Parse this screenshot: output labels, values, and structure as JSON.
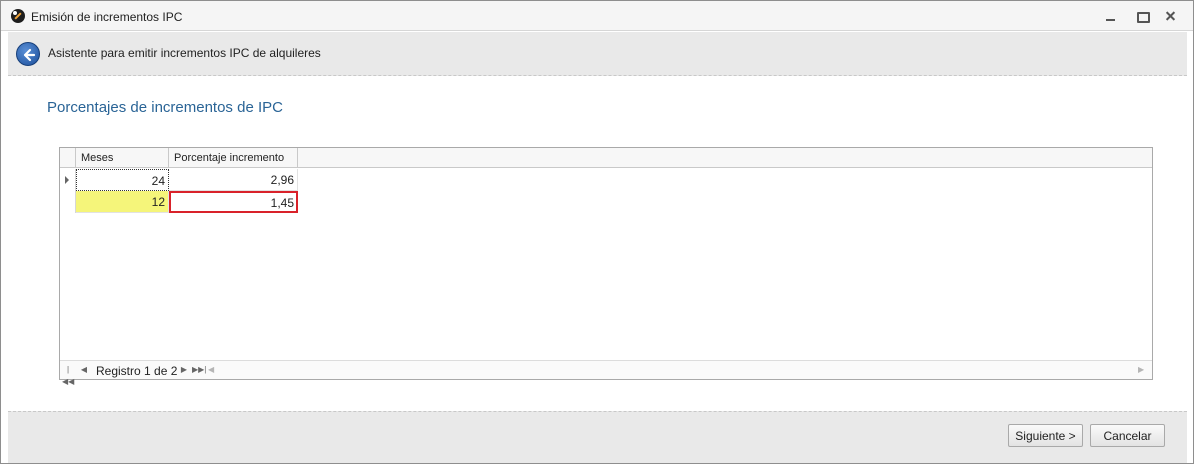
{
  "window": {
    "title": "Emisión de incrementos IPC",
    "icon": "app-logo-icon",
    "controls": [
      "minimize-icon",
      "maximize-icon",
      "close-icon"
    ]
  },
  "header": {
    "back_icon": "back-arrow-icon",
    "title": "Asistente para emitir incrementos IPC de alquileres"
  },
  "section": {
    "title": "Porcentajes de incrementos de IPC"
  },
  "grid": {
    "columns": [
      "Meses",
      "Porcentaje incremento"
    ],
    "rows": [
      {
        "meses": "24",
        "porcentaje": "2,96"
      },
      {
        "meses": "12",
        "porcentaje": "1,45"
      }
    ],
    "highlight_color": "#f5f57a",
    "error_color": "#d9222a"
  },
  "navigator": {
    "record_text": "Registro 1 de 2",
    "icons": [
      "first-record-icon",
      "prev-record-icon",
      "next-record-icon",
      "last-record-icon"
    ]
  },
  "footer": {
    "next_label": "Siguiente >",
    "cancel_label": "Cancelar"
  }
}
